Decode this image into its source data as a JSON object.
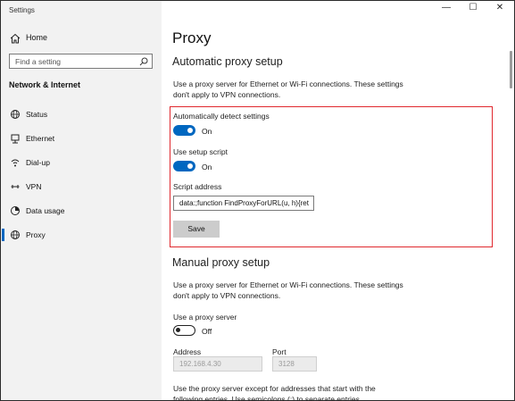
{
  "window": {
    "title": "Settings",
    "controls": {
      "minimize": "—",
      "maximize": "☐",
      "close": "✕"
    }
  },
  "sidebar": {
    "home_label": "Home",
    "search_placeholder": "Find a setting",
    "section_title": "Network & Internet",
    "items": [
      {
        "label": "Status",
        "icon": "globe-icon"
      },
      {
        "label": "Ethernet",
        "icon": "ethernet-icon"
      },
      {
        "label": "Dial-up",
        "icon": "dialup-icon"
      },
      {
        "label": "VPN",
        "icon": "vpn-icon"
      },
      {
        "label": "Data usage",
        "icon": "data-usage-icon"
      },
      {
        "label": "Proxy",
        "icon": "proxy-globe-icon",
        "active": true
      }
    ]
  },
  "main": {
    "title": "Proxy",
    "auto": {
      "heading": "Automatic proxy setup",
      "description": "Use a proxy server for Ethernet or Wi-Fi connections. These settings don't apply to VPN connections.",
      "detect_label": "Automatically detect settings",
      "detect_state": "On",
      "script_label": "Use setup script",
      "script_state": "On",
      "address_label": "Script address",
      "address_value": "data:;function FindProxyForURL(u, h){ret",
      "save_label": "Save"
    },
    "manual": {
      "heading": "Manual proxy setup",
      "description": "Use a proxy server for Ethernet or Wi-Fi connections. These settings don't apply to VPN connections.",
      "use_label": "Use a proxy server",
      "use_state": "Off",
      "address_label": "Address",
      "address_value": "192.168.4.30",
      "port_label": "Port",
      "port_value": "3128",
      "exceptions_text": "Use the proxy server except for addresses that start with the following entries. Use semicolons (;) to separate entries."
    }
  },
  "colors": {
    "accent": "#0067c0",
    "highlight_border": "#e0282e",
    "sidebar_bg": "#f2f2f2"
  }
}
